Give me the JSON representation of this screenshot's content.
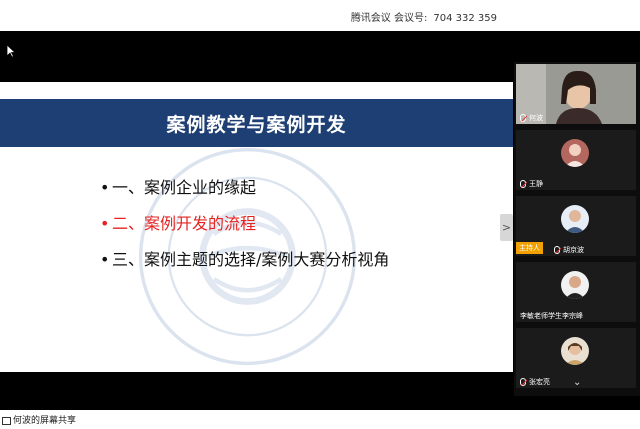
{
  "meeting": {
    "label": "腾讯会议  会议号:",
    "number": "704 332 359"
  },
  "slide": {
    "title": "案例教学与案例开发",
    "bullets": [
      {
        "text": "一、案例企业的缘起",
        "active": false
      },
      {
        "text": "二、案例开发的流程",
        "active": true
      },
      {
        "text": "三、案例主题的选择/案例大赛分析视角",
        "active": false
      }
    ],
    "next_icon": ">"
  },
  "participants": [
    {
      "name": "何波",
      "has_video": true
    },
    {
      "name": "王静",
      "has_video": false
    },
    {
      "name": "胡京波",
      "has_video": false,
      "badge": "主持人"
    },
    {
      "name": "李敏老师学生李宗峰",
      "has_video": false
    },
    {
      "name": "张宏亮",
      "has_video": false
    }
  ],
  "scroll_icon": "chevron-down-icon",
  "share": {
    "label": "何波的屏幕共享"
  },
  "colors": {
    "slide_header": "#1e3f74",
    "active_bullet": "#e52421",
    "host_badge": "#f2a100"
  }
}
